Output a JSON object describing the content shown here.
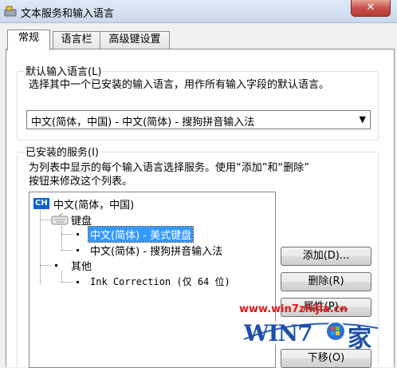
{
  "window": {
    "title": "文本服务和输入语言",
    "close_glyph": "✕"
  },
  "tabs": [
    {
      "label": "常规",
      "active": true
    },
    {
      "label": "语言栏",
      "active": false
    },
    {
      "label": "高级键设置",
      "active": false
    }
  ],
  "default_language": {
    "legend": "默认输入语言(L)",
    "description": "选择其中一个已安装的输入语言，用作所有输入字段的默认语言。",
    "selected_value": "中文(简体，中国) - 中文(简体) - 搜狗拼音输入法"
  },
  "installed_services": {
    "legend": "已安装的服务(I)",
    "description_line1": "为列表中显示的每个输入语言选择服务。使用“添加”和“删除”",
    "description_line2": "按钮来修改这个列表。",
    "tree": {
      "language_badge": "CH",
      "language": "中文(简体，中国)",
      "keyboard_label": "键盘",
      "keyboard_items": [
        {
          "label": "中文(简体) - 美式键盘",
          "selected": true
        },
        {
          "label": "中文(简体) - 搜狗拼音输入法",
          "selected": false
        }
      ],
      "other_label": "其他",
      "other_items": [
        {
          "label": "Ink Correction (仅 64 位)"
        }
      ]
    },
    "buttons": {
      "add": "添加(D)...",
      "remove": "删除(R)",
      "properties": "属性(P)...",
      "move_down": "下移(O)"
    }
  },
  "watermark": {
    "url": "www.win7zhijia.cn",
    "logo_text": "WIN7",
    "logo_suffix": "家"
  }
}
